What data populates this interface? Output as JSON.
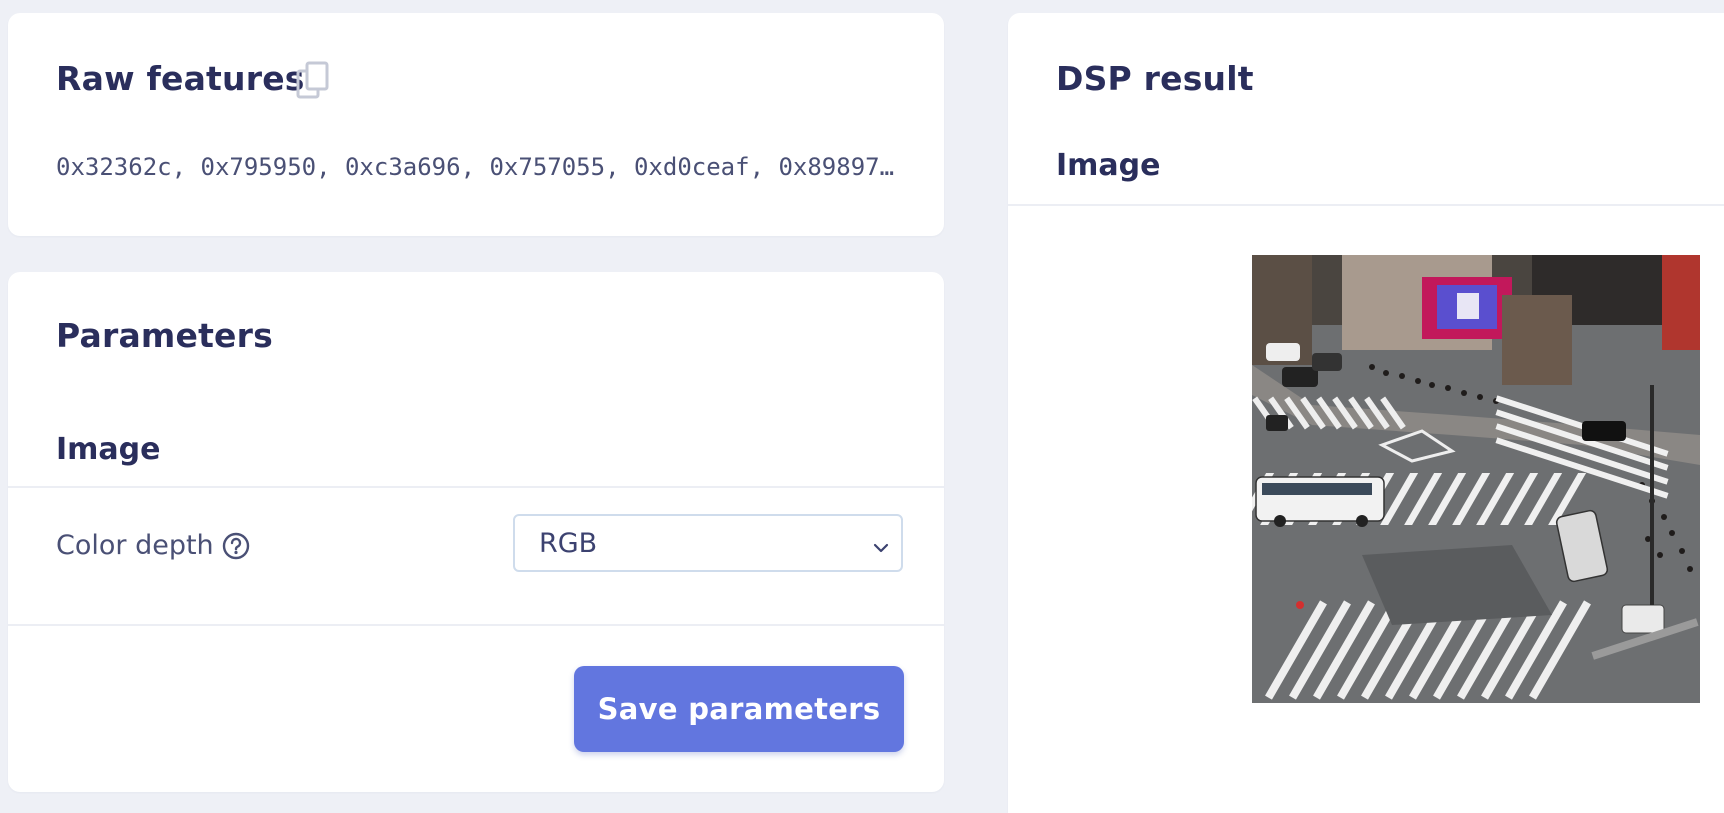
{
  "raw_features": {
    "title": "Raw features",
    "copy_icon": "copy-icon",
    "values": "0x32362c, 0x795950, 0xc3a696, 0x757055, 0xd0ceaf, 0x89897…"
  },
  "parameters": {
    "title": "Parameters",
    "section_title": "Image",
    "color_depth": {
      "label": "Color depth",
      "help_icon": "question-circle-icon",
      "selected_value": "RGB",
      "chevron_icon": "chevron-down-icon"
    },
    "save_label": "Save parameters"
  },
  "dsp_result": {
    "title": "DSP result",
    "section_title": "Image",
    "image_alt": "Processed image of a busy city intersection with crosswalks, buses, cars and crowds"
  },
  "colors": {
    "page_background": "#eef0f6",
    "card_background": "#ffffff",
    "heading": "#2a2e5c",
    "body_text": "#4a5075",
    "accent_button": "#6276df",
    "select_border": "#cfdcec"
  }
}
